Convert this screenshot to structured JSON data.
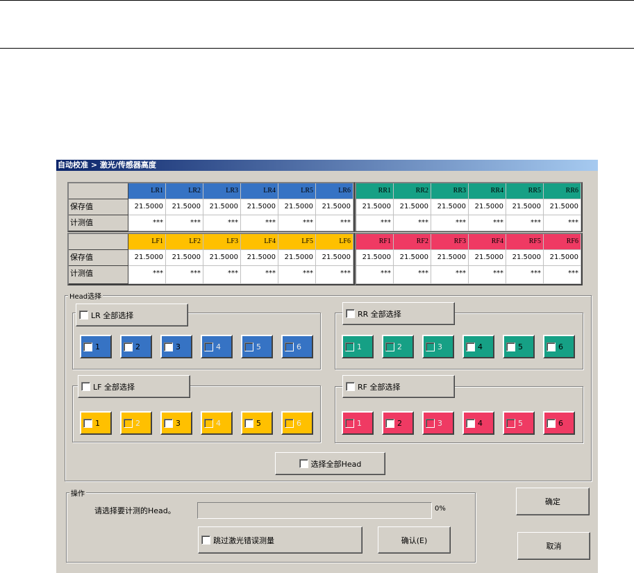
{
  "title": "自动校准 > 激光/传感器高度",
  "row_labels": {
    "saved": "保存值",
    "measured": "计测值"
  },
  "tables": {
    "LR": {
      "color": "#3673c4",
      "cols": [
        "LR1",
        "LR2",
        "LR3",
        "LR4",
        "LR5",
        "LR6"
      ],
      "saved": [
        "21.5000",
        "21.5000",
        "21.5000",
        "21.5000",
        "21.5000",
        "21.5000"
      ],
      "measured": [
        "***",
        "***",
        "***",
        "***",
        "***",
        "***"
      ]
    },
    "RR": {
      "color": "#16a085",
      "cols": [
        "RR1",
        "RR2",
        "RR3",
        "RR4",
        "RR5",
        "RR6"
      ],
      "saved": [
        "21.5000",
        "21.5000",
        "21.5000",
        "21.5000",
        "21.5000",
        "21.5000"
      ],
      "measured": [
        "***",
        "***",
        "***",
        "***",
        "***",
        "***"
      ]
    },
    "LF": {
      "color": "#ffc000",
      "cols": [
        "LF1",
        "LF2",
        "LF3",
        "LF4",
        "LF5",
        "LF6"
      ],
      "saved": [
        "21.5000",
        "21.5000",
        "21.5000",
        "21.5000",
        "21.5000",
        "21.5000"
      ],
      "measured": [
        "***",
        "***",
        "***",
        "***",
        "***",
        "***"
      ]
    },
    "RF": {
      "color": "#ef3a63",
      "cols": [
        "RF1",
        "RF2",
        "RF3",
        "RF4",
        "RF5",
        "RF6"
      ],
      "saved": [
        "21.5000",
        "21.5000",
        "21.5000",
        "21.5000",
        "21.5000",
        "21.5000"
      ],
      "measured": [
        "***",
        "***",
        "***",
        "***",
        "***",
        "***"
      ]
    }
  },
  "head_select": {
    "legend": "Head选择",
    "groups": {
      "LR": {
        "label": "LR 全部选择",
        "heads": [
          {
            "n": "1",
            "enabled": true
          },
          {
            "n": "2",
            "enabled": true
          },
          {
            "n": "3",
            "enabled": true
          },
          {
            "n": "4",
            "enabled": false
          },
          {
            "n": "5",
            "enabled": false
          },
          {
            "n": "6",
            "enabled": false
          }
        ]
      },
      "LF": {
        "label": "LF 全部选择",
        "heads": [
          {
            "n": "1",
            "enabled": true
          },
          {
            "n": "2",
            "enabled": false
          },
          {
            "n": "3",
            "enabled": true
          },
          {
            "n": "4",
            "enabled": false
          },
          {
            "n": "5",
            "enabled": true
          },
          {
            "n": "6",
            "enabled": false
          }
        ]
      },
      "RR": {
        "label": "RR 全部选择",
        "heads": [
          {
            "n": "1",
            "enabled": false
          },
          {
            "n": "2",
            "enabled": false
          },
          {
            "n": "3",
            "enabled": false
          },
          {
            "n": "4",
            "enabled": true
          },
          {
            "n": "5",
            "enabled": true
          },
          {
            "n": "6",
            "enabled": true
          }
        ]
      },
      "RF": {
        "label": "RF 全部选择",
        "heads": [
          {
            "n": "1",
            "enabled": false
          },
          {
            "n": "2",
            "enabled": true
          },
          {
            "n": "3",
            "enabled": false
          },
          {
            "n": "4",
            "enabled": true
          },
          {
            "n": "5",
            "enabled": false
          },
          {
            "n": "6",
            "enabled": true
          }
        ]
      }
    },
    "select_all": "选择全部Head"
  },
  "operation": {
    "legend": "操作",
    "prompt": "请选择要计测的Head。",
    "progress_percent": 0,
    "progress_text": "0%",
    "skip_label": "跳过激光错误测量",
    "confirm_label": "确认(E)"
  },
  "ok_label": "确定",
  "cancel_label": "取消"
}
